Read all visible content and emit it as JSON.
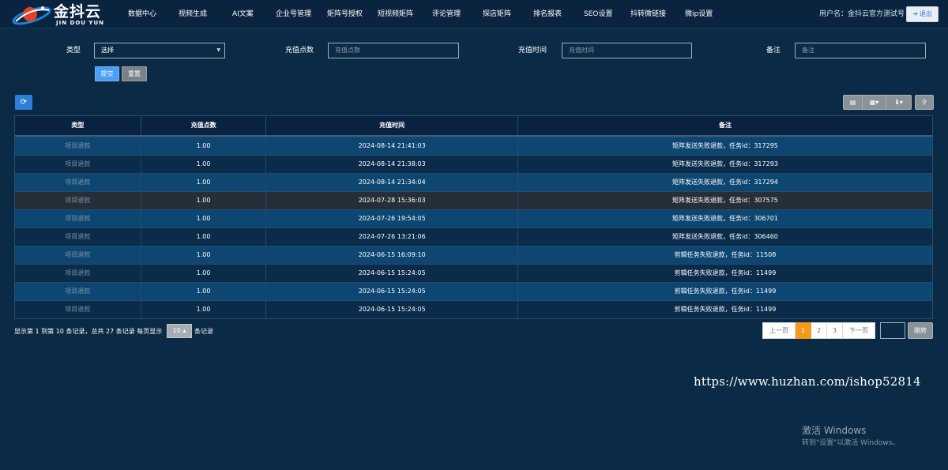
{
  "app": {
    "logo_text": "金抖云",
    "logo_sub": "JIN DOU YUN"
  },
  "nav": {
    "items": [
      "数据中心",
      "视频生成",
      "AI文案",
      "企业号管理",
      "矩阵号授权",
      "短视频矩阵",
      "评论管理",
      "探店矩阵",
      "排名报表",
      "SEO设置",
      "抖转微链接",
      "微ip设置"
    ]
  },
  "header": {
    "user_label": "用户名：金抖云官方测试号",
    "logout_label": "退出"
  },
  "filters": {
    "type_label": "类型",
    "type_value": "选择",
    "points_label": "充值点数",
    "points_placeholder": "充值点数",
    "time_label": "充值时间",
    "time_placeholder": "充值时间",
    "remark_label": "备注",
    "remark_placeholder": "备注",
    "submit_label": "提交",
    "reset_label": "重置"
  },
  "toolbar": {
    "refresh_icon": "refresh-icon",
    "list_icon": "list-icon",
    "columns_icon": "columns-icon",
    "export_icon": "export-icon",
    "search_icon": "search-icon"
  },
  "table": {
    "columns": [
      "类型",
      "充值点数",
      "充值时间",
      "备注"
    ],
    "rows": [
      {
        "type": "项目退款",
        "points": "1.00",
        "time": "2024-08-14 21:41:03",
        "remark": "矩阵发送失败退款，任务id：317295"
      },
      {
        "type": "项目退款",
        "points": "1.00",
        "time": "2024-08-14 21:38:03",
        "remark": "矩阵发送失败退款，任务id：317293"
      },
      {
        "type": "项目退款",
        "points": "1.00",
        "time": "2024-08-14 21:34:04",
        "remark": "矩阵发送失败退款，任务id：317294"
      },
      {
        "type": "项目退款",
        "points": "1.00",
        "time": "2024-07-28 15:36:03",
        "remark": "矩阵发送失败退款，任务id：307575"
      },
      {
        "type": "项目退款",
        "points": "1.00",
        "time": "2024-07-26 19:54:05",
        "remark": "矩阵发送失败退款，任务id：306701"
      },
      {
        "type": "项目退款",
        "points": "1.00",
        "time": "2024-07-26 13:21:06",
        "remark": "矩阵发送失败退款，任务id：306460"
      },
      {
        "type": "项目退款",
        "points": "1.00",
        "time": "2024-06-15 16:09:10",
        "remark": "剪辑任务失败退款，任务id：11508"
      },
      {
        "type": "项目退款",
        "points": "1.00",
        "time": "2024-06-15 15:24:05",
        "remark": "剪辑任务失败退款，任务id：11499"
      },
      {
        "type": "项目退款",
        "points": "1.00",
        "time": "2024-06-15 15:24:05",
        "remark": "剪辑任务失败退款，任务id：11499"
      },
      {
        "type": "项目退款",
        "points": "1.00",
        "time": "2024-06-15 15:24:05",
        "remark": "剪辑任务失败退款，任务id：11499"
      }
    ]
  },
  "pagination": {
    "info_prefix": "显示第 1 到第 10 条记录，总共 27 条记录 每页显示",
    "page_size": "10",
    "info_suffix": "条记录",
    "prev_label": "上一页",
    "pages": [
      "1",
      "2",
      "3"
    ],
    "active_page": "1",
    "next_label": "下一页",
    "jump_label": "跳转"
  },
  "overlay": {
    "url_text": "https://www.huzhan.com/ishop52814",
    "activate_title": "激活 Windows",
    "activate_sub": "转到\"设置\"以激活 Windows。"
  },
  "colors": {
    "background": "#0b2a45",
    "row_highlight": "#0e4672",
    "row_selected": "#262f38",
    "accent_blue": "#4b9ef5",
    "active_page": "#f39a1a"
  }
}
